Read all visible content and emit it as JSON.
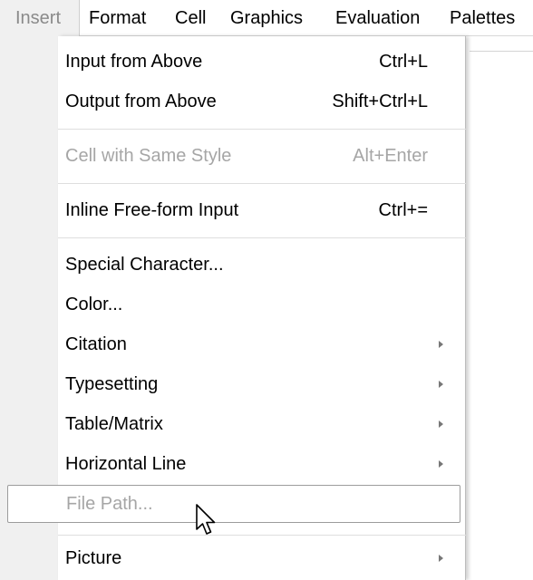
{
  "menubar": {
    "items": [
      {
        "label": "Insert"
      },
      {
        "label": "Format"
      },
      {
        "label": "Cell"
      },
      {
        "label": "Graphics"
      },
      {
        "label": "Evaluation"
      },
      {
        "label": "Palettes"
      }
    ],
    "active_index": 0
  },
  "insert_menu": {
    "items": [
      {
        "label": "Input from Above",
        "shortcut": "Ctrl+L",
        "enabled": true
      },
      {
        "label": "Output from Above",
        "shortcut": "Shift+Ctrl+L",
        "enabled": true
      },
      {
        "label": "Cell with Same Style",
        "shortcut": "Alt+Enter",
        "enabled": false
      },
      {
        "label": "Inline Free-form Input",
        "shortcut": "Ctrl+=",
        "enabled": true
      },
      {
        "label": "Special Character...",
        "shortcut": "",
        "enabled": true
      },
      {
        "label": "Color...",
        "shortcut": "",
        "enabled": true
      },
      {
        "label": "Citation",
        "shortcut": "",
        "enabled": true,
        "submenu": true
      },
      {
        "label": "Typesetting",
        "shortcut": "",
        "enabled": true,
        "submenu": true
      },
      {
        "label": "Table/Matrix",
        "shortcut": "",
        "enabled": true,
        "submenu": true
      },
      {
        "label": "Horizontal Line",
        "shortcut": "",
        "enabled": true,
        "submenu": true
      },
      {
        "label": "File Path...",
        "shortcut": "",
        "enabled": false,
        "hovered": true
      },
      {
        "label": "Picture",
        "shortcut": "",
        "enabled": true,
        "submenu": true
      }
    ]
  },
  "icons": {
    "submenu_arrow": "chevron-right-icon",
    "cursor": "mouse-pointer-icon"
  },
  "colors": {
    "disabled_text": "#a6a6a6",
    "menu_background": "#ffffff",
    "gutter_background": "#f0f0f0"
  }
}
